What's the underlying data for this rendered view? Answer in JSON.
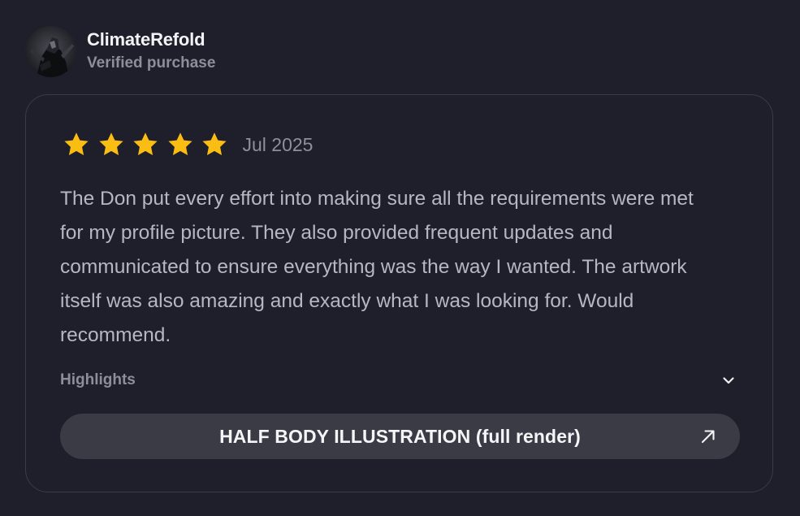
{
  "reviewer": {
    "name": "ClimateRefold",
    "subtitle": "Verified purchase",
    "avatar_icon": "reviewer-avatar"
  },
  "review": {
    "rating": 5,
    "max_rating": 5,
    "star_color": "#f9bd13",
    "date": "Jul 2025",
    "body": "The Don put every effort into making sure all the requirements were met for my profile picture. They also provided frequent updates and communicated to ensure everything was the way I wanted. The artwork itself was also amazing and exactly what I was looking for. Would recommend.",
    "highlights_label": "Highlights",
    "highlights_icon": "chevron-down-icon"
  },
  "service": {
    "label": "HALF BODY ILLUSTRATION (full render)",
    "icon": "arrow-up-right-icon"
  }
}
